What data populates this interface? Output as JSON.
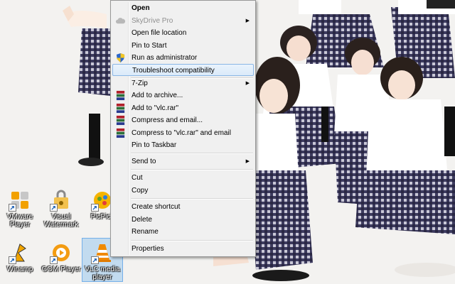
{
  "desktop": {
    "icons": [
      {
        "label": "VMware Player",
        "icon": "vmware-icon"
      },
      {
        "label": "Visual Watermark",
        "icon": "visual-watermark-icon"
      },
      {
        "label": "PicPick",
        "icon": "picpick-icon"
      },
      {
        "label": "Winamp",
        "icon": "winamp-icon"
      },
      {
        "label": "GOM Player",
        "icon": "gom-player-icon"
      },
      {
        "label": "VLC media player",
        "icon": "vlc-cone-icon",
        "selected": true
      }
    ]
  },
  "context_menu": {
    "items": {
      "open": "Open",
      "skydrive_pro": "SkyDrive Pro",
      "open_file_location": "Open file location",
      "pin_to_start": "Pin to Start",
      "run_as_admin": "Run as administrator",
      "troubleshoot": "Troubleshoot compatibility",
      "seven_zip": "7-Zip",
      "add_to_archive": "Add to archive...",
      "add_to_vlc_rar": "Add to \"vlc.rar\"",
      "compress_and_email": "Compress and email...",
      "compress_to_vlc_rar_email": "Compress to \"vlc.rar\" and email",
      "pin_to_taskbar": "Pin to Taskbar",
      "send_to": "Send to",
      "cut": "Cut",
      "copy": "Copy",
      "create_shortcut": "Create shortcut",
      "delete": "Delete",
      "rename": "Rename",
      "properties": "Properties"
    },
    "highlighted_item": "troubleshoot",
    "disabled_item": "skydrive_pro",
    "submenu_arrow": "▶"
  },
  "colors": {
    "menu_bg": "#f0f0f0",
    "highlight_border": "#8ab6e6",
    "winrar_red": "#b1202b",
    "vlc_orange": "#f08a00"
  }
}
